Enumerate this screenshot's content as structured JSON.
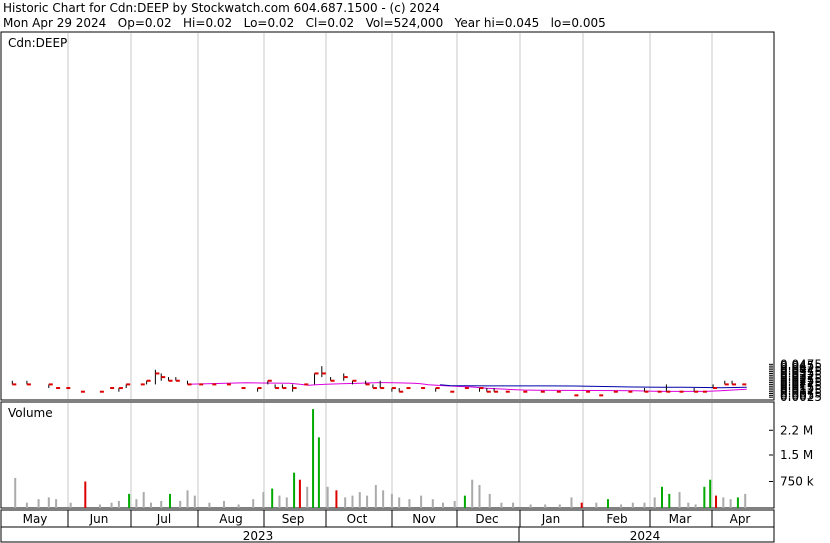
{
  "header": {
    "line1": "Historic Chart for Cdn:DEEP by Stockwatch.com 604.687.1500 - (c) 2024",
    "line2": "Mon Apr 29 2024   Op=0.02   Hi=0.02   Lo=0.02   Cl=0.02   Vol=524,000   Year hi=0.045   lo=0.005"
  },
  "price_panel": {
    "label": "Cdn:DEEP"
  },
  "volume_panel": {
    "label": "Volume"
  },
  "chart_data": [
    {
      "type": "line",
      "title": "Cdn:DEEP",
      "ylim": [
        0,
        0.05
      ],
      "y_ticks": [
        "0.0025",
        "0.005",
        "0.0075",
        "0.01",
        "0.0125",
        "0.015",
        "0.0175",
        "0.02",
        "0.0225",
        "0.025",
        "0.0275",
        "0.03",
        "0.0325",
        "0.035",
        "0.0375",
        "0.04",
        "0.0425",
        "0.045",
        "0.0475"
      ],
      "x_ticks": [
        "May",
        "Jun",
        "Jul",
        "Aug",
        "Sep",
        "Oct",
        "Nov",
        "Dec",
        "Jan",
        "Feb",
        "Mar",
        "Apr"
      ],
      "year_labels": [
        "2023",
        "2024"
      ],
      "colors": {
        "bar": "#000000",
        "close": "#dd0000",
        "ma_short": "#dd00dd",
        "ma_long": "#0000aa",
        "grid": "#c8c8c8"
      },
      "bars": [
        {
          "x": 0.5,
          "lo": 0.02,
          "hi": 0.025,
          "c": 0.02
        },
        {
          "x": 1.5,
          "lo": 0.02,
          "hi": 0.025,
          "c": 0.02
        },
        {
          "x": 3,
          "lo": 0.015,
          "hi": 0.02,
          "c": 0.02
        },
        {
          "x": 3.5,
          "lo": 0.015,
          "hi": 0.015,
          "c": 0.015
        },
        {
          "x": 4.2,
          "lo": 0.015,
          "hi": 0.015,
          "c": 0.015
        },
        {
          "x": 5.2,
          "lo": 0.01,
          "hi": 0.01,
          "c": 0.01
        },
        {
          "x": 6.5,
          "lo": 0.01,
          "hi": 0.01,
          "c": 0.01
        },
        {
          "x": 7.2,
          "lo": 0.015,
          "hi": 0.015,
          "c": 0.015
        },
        {
          "x": 7.8,
          "lo": 0.01,
          "hi": 0.015,
          "c": 0.015
        },
        {
          "x": 8.3,
          "lo": 0.015,
          "hi": 0.02,
          "c": 0.02
        },
        {
          "x": 9.3,
          "lo": 0.02,
          "hi": 0.02,
          "c": 0.02
        },
        {
          "x": 9.7,
          "lo": 0.02,
          "hi": 0.025,
          "c": 0.025
        },
        {
          "x": 10.3,
          "lo": 0.02,
          "hi": 0.04,
          "c": 0.035
        },
        {
          "x": 10.7,
          "lo": 0.025,
          "hi": 0.035,
          "c": 0.03
        },
        {
          "x": 11.2,
          "lo": 0.025,
          "hi": 0.03,
          "c": 0.025
        },
        {
          "x": 11.7,
          "lo": 0.025,
          "hi": 0.03,
          "c": 0.025
        },
        {
          "x": 12.5,
          "lo": 0.02,
          "hi": 0.025,
          "c": 0.02
        },
        {
          "x": 13.3,
          "lo": 0.02,
          "hi": 0.02,
          "c": 0.02
        },
        {
          "x": 14.2,
          "lo": 0.02,
          "hi": 0.02,
          "c": 0.02
        },
        {
          "x": 15.2,
          "lo": 0.02,
          "hi": 0.02,
          "c": 0.02
        },
        {
          "x": 16.2,
          "lo": 0.015,
          "hi": 0.015,
          "c": 0.015
        },
        {
          "x": 17.3,
          "lo": 0.01,
          "hi": 0.015,
          "c": 0.015
        },
        {
          "x": 18,
          "lo": 0.02,
          "hi": 0.025,
          "c": 0.025
        },
        {
          "x": 18.5,
          "lo": 0.015,
          "hi": 0.02,
          "c": 0.015
        },
        {
          "x": 19,
          "lo": 0.015,
          "hi": 0.02,
          "c": 0.015
        },
        {
          "x": 19.7,
          "lo": 0.01,
          "hi": 0.02,
          "c": 0.015
        },
        {
          "x": 20.5,
          "lo": 0.02,
          "hi": 0.02,
          "c": 0.02
        },
        {
          "x": 21.2,
          "lo": 0.02,
          "hi": 0.035,
          "c": 0.035
        },
        {
          "x": 21.7,
          "lo": 0.03,
          "hi": 0.045,
          "c": 0.035
        },
        {
          "x": 22.3,
          "lo": 0.025,
          "hi": 0.03,
          "c": 0.025
        },
        {
          "x": 23.2,
          "lo": 0.025,
          "hi": 0.035,
          "c": 0.03
        },
        {
          "x": 23.8,
          "lo": 0.02,
          "hi": 0.025,
          "c": 0.025
        },
        {
          "x": 24.7,
          "lo": 0.02,
          "hi": 0.025,
          "c": 0.02
        },
        {
          "x": 25.2,
          "lo": 0.015,
          "hi": 0.02,
          "c": 0.015
        },
        {
          "x": 25.7,
          "lo": 0.015,
          "hi": 0.025,
          "c": 0.015
        },
        {
          "x": 26.5,
          "lo": 0.01,
          "hi": 0.015,
          "c": 0.015
        },
        {
          "x": 27,
          "lo": 0.01,
          "hi": 0.015,
          "c": 0.01
        },
        {
          "x": 27.5,
          "lo": 0.015,
          "hi": 0.015,
          "c": 0.015
        },
        {
          "x": 28.5,
          "lo": 0.015,
          "hi": 0.015,
          "c": 0.015
        },
        {
          "x": 29.5,
          "lo": 0.01,
          "hi": 0.015,
          "c": 0.015
        },
        {
          "x": 30.5,
          "lo": 0.01,
          "hi": 0.01,
          "c": 0.01
        },
        {
          "x": 31.5,
          "lo": 0.015,
          "hi": 0.015,
          "c": 0.015
        },
        {
          "x": 32.5,
          "lo": 0.01,
          "hi": 0.015,
          "c": 0.015
        },
        {
          "x": 33,
          "lo": 0.01,
          "hi": 0.015,
          "c": 0.01
        },
        {
          "x": 33.5,
          "lo": 0.01,
          "hi": 0.015,
          "c": 0.01
        },
        {
          "x": 34.3,
          "lo": 0.01,
          "hi": 0.01,
          "c": 0.01
        },
        {
          "x": 35.5,
          "lo": 0.01,
          "hi": 0.01,
          "c": 0.01
        },
        {
          "x": 36.7,
          "lo": 0.01,
          "hi": 0.01,
          "c": 0.01
        },
        {
          "x": 37.8,
          "lo": 0.01,
          "hi": 0.01,
          "c": 0.01
        },
        {
          "x": 39,
          "lo": 0.005,
          "hi": 0.005,
          "c": 0.005
        },
        {
          "x": 39.8,
          "lo": 0.01,
          "hi": 0.01,
          "c": 0.01
        },
        {
          "x": 40.7,
          "lo": 0.005,
          "hi": 0.005,
          "c": 0.005
        },
        {
          "x": 41.7,
          "lo": 0.01,
          "hi": 0.01,
          "c": 0.01
        },
        {
          "x": 42.7,
          "lo": 0.01,
          "hi": 0.01,
          "c": 0.01
        },
        {
          "x": 43.8,
          "lo": 0.01,
          "hi": 0.015,
          "c": 0.01
        },
        {
          "x": 44.7,
          "lo": 0.01,
          "hi": 0.01,
          "c": 0.01
        },
        {
          "x": 45.3,
          "lo": 0.01,
          "hi": 0.02,
          "c": 0.01
        },
        {
          "x": 46.2,
          "lo": 0.01,
          "hi": 0.01,
          "c": 0.01
        },
        {
          "x": 47.2,
          "lo": 0.01,
          "hi": 0.015,
          "c": 0.01
        },
        {
          "x": 47.8,
          "lo": 0.01,
          "hi": 0.01,
          "c": 0.01
        },
        {
          "x": 48.5,
          "lo": 0.015,
          "hi": 0.02,
          "c": 0.015
        },
        {
          "x": 49.3,
          "lo": 0.02,
          "hi": 0.025,
          "c": 0.02
        },
        {
          "x": 49.8,
          "lo": 0.02,
          "hi": 0.025,
          "c": 0.02
        },
        {
          "x": 50.5,
          "lo": 0.02,
          "hi": 0.02,
          "c": 0.02
        }
      ],
      "ma_short": [
        [
          12.5,
          0.0202
        ],
        [
          14.5,
          0.0213
        ],
        [
          15.5,
          0.0218
        ],
        [
          16.5,
          0.0222
        ],
        [
          17.5,
          0.0219
        ],
        [
          18.5,
          0.0218
        ],
        [
          19.5,
          0.0215
        ],
        [
          20.2,
          0.0203
        ],
        [
          20.8,
          0.0189
        ],
        [
          21.3,
          0.0196
        ],
        [
          22,
          0.0203
        ],
        [
          23,
          0.0208
        ],
        [
          24,
          0.0214
        ],
        [
          25,
          0.0221
        ],
        [
          26,
          0.0224
        ],
        [
          27,
          0.0221
        ],
        [
          28,
          0.0217
        ],
        [
          28.5,
          0.0209
        ],
        [
          29,
          0.0196
        ],
        [
          30,
          0.0183
        ],
        [
          31,
          0.0172
        ],
        [
          32,
          0.0164
        ],
        [
          33,
          0.0147
        ],
        [
          34,
          0.0137
        ],
        [
          35,
          0.0128
        ],
        [
          35.5,
          0.0123
        ],
        [
          36.5,
          0.0121
        ],
        [
          38,
          0.0118
        ],
        [
          40,
          0.0116
        ],
        [
          42,
          0.0115
        ],
        [
          43,
          0.0114
        ],
        [
          44,
          0.0108
        ],
        [
          45,
          0.0104
        ],
        [
          47,
          0.0104
        ],
        [
          48,
          0.0104
        ],
        [
          49,
          0.0112
        ],
        [
          50,
          0.0124
        ],
        [
          50.8,
          0.0133
        ]
      ],
      "ma_long": [
        [
          29.8,
          0.0195
        ],
        [
          30.5,
          0.0183
        ],
        [
          31.5,
          0.0181
        ],
        [
          33,
          0.018
        ],
        [
          35,
          0.0179
        ],
        [
          37,
          0.0179
        ],
        [
          39,
          0.0178
        ],
        [
          40,
          0.0174
        ],
        [
          41,
          0.0171
        ],
        [
          42,
          0.0167
        ],
        [
          43,
          0.0165
        ],
        [
          44,
          0.0163
        ],
        [
          45,
          0.0161
        ],
        [
          46.5,
          0.016
        ],
        [
          48,
          0.0158
        ],
        [
          49,
          0.0155
        ],
        [
          50,
          0.0158
        ],
        [
          50.8,
          0.016
        ]
      ]
    },
    {
      "type": "bar",
      "title": "Volume",
      "ylim": [
        0,
        3000000
      ],
      "y_ticks": [
        "750 k",
        "1.5 M",
        "2.2 M"
      ],
      "colors": {
        "black": "#000000",
        "red": "#dd0000",
        "green": "#00aa00",
        "grey": "#aaaaaa"
      },
      "bars": [
        {
          "x": 0.7,
          "v": 850000,
          "c": "grey"
        },
        {
          "x": 1.5,
          "v": 150000,
          "c": "grey"
        },
        {
          "x": 2.3,
          "v": 250000,
          "c": "grey"
        },
        {
          "x": 3,
          "v": 300000,
          "c": "grey"
        },
        {
          "x": 3.5,
          "v": 250000,
          "c": "grey"
        },
        {
          "x": 4.5,
          "v": 150000,
          "c": "grey"
        },
        {
          "x": 5.5,
          "v": 750000,
          "c": "red"
        },
        {
          "x": 6.5,
          "v": 100000,
          "c": "grey"
        },
        {
          "x": 7.3,
          "v": 150000,
          "c": "grey"
        },
        {
          "x": 7.8,
          "v": 200000,
          "c": "grey"
        },
        {
          "x": 8.5,
          "v": 400000,
          "c": "green"
        },
        {
          "x": 9,
          "v": 250000,
          "c": "grey"
        },
        {
          "x": 9.5,
          "v": 450000,
          "c": "grey"
        },
        {
          "x": 10,
          "v": 150000,
          "c": "grey"
        },
        {
          "x": 10.7,
          "v": 200000,
          "c": "grey"
        },
        {
          "x": 11.3,
          "v": 400000,
          "c": "green"
        },
        {
          "x": 12,
          "v": 200000,
          "c": "grey"
        },
        {
          "x": 12.5,
          "v": 500000,
          "c": "grey"
        },
        {
          "x": 13,
          "v": 350000,
          "c": "grey"
        },
        {
          "x": 14,
          "v": 150000,
          "c": "grey"
        },
        {
          "x": 15,
          "v": 200000,
          "c": "grey"
        },
        {
          "x": 16,
          "v": 100000,
          "c": "grey"
        },
        {
          "x": 17,
          "v": 250000,
          "c": "grey"
        },
        {
          "x": 17.7,
          "v": 450000,
          "c": "grey"
        },
        {
          "x": 18.3,
          "v": 550000,
          "c": "green"
        },
        {
          "x": 18.8,
          "v": 350000,
          "c": "grey"
        },
        {
          "x": 19.3,
          "v": 300000,
          "c": "grey"
        },
        {
          "x": 19.8,
          "v": 1000000,
          "c": "green"
        },
        {
          "x": 20.2,
          "v": 800000,
          "c": "red"
        },
        {
          "x": 20.7,
          "v": 600000,
          "c": "grey"
        },
        {
          "x": 21.1,
          "v": 2800000,
          "c": "green"
        },
        {
          "x": 21.5,
          "v": 2000000,
          "c": "green"
        },
        {
          "x": 22.1,
          "v": 600000,
          "c": "grey"
        },
        {
          "x": 22.7,
          "v": 500000,
          "c": "red"
        },
        {
          "x": 23.3,
          "v": 300000,
          "c": "grey"
        },
        {
          "x": 23.8,
          "v": 350000,
          "c": "grey"
        },
        {
          "x": 24.3,
          "v": 450000,
          "c": "grey"
        },
        {
          "x": 24.8,
          "v": 350000,
          "c": "grey"
        },
        {
          "x": 25.4,
          "v": 650000,
          "c": "grey"
        },
        {
          "x": 25.9,
          "v": 500000,
          "c": "grey"
        },
        {
          "x": 26.5,
          "v": 400000,
          "c": "grey"
        },
        {
          "x": 27,
          "v": 300000,
          "c": "grey"
        },
        {
          "x": 27.7,
          "v": 250000,
          "c": "grey"
        },
        {
          "x": 28.5,
          "v": 350000,
          "c": "grey"
        },
        {
          "x": 29.3,
          "v": 250000,
          "c": "grey"
        },
        {
          "x": 30,
          "v": 150000,
          "c": "grey"
        },
        {
          "x": 30.8,
          "v": 200000,
          "c": "grey"
        },
        {
          "x": 31.5,
          "v": 350000,
          "c": "green"
        },
        {
          "x": 32,
          "v": 800000,
          "c": "grey"
        },
        {
          "x": 32.5,
          "v": 650000,
          "c": "grey"
        },
        {
          "x": 33.2,
          "v": 400000,
          "c": "grey"
        },
        {
          "x": 34,
          "v": 150000,
          "c": "grey"
        },
        {
          "x": 34.8,
          "v": 150000,
          "c": "grey"
        },
        {
          "x": 36,
          "v": 100000,
          "c": "grey"
        },
        {
          "x": 37,
          "v": 100000,
          "c": "grey"
        },
        {
          "x": 38,
          "v": 100000,
          "c": "grey"
        },
        {
          "x": 38.8,
          "v": 300000,
          "c": "grey"
        },
        {
          "x": 39.5,
          "v": 150000,
          "c": "red"
        },
        {
          "x": 40.5,
          "v": 150000,
          "c": "grey"
        },
        {
          "x": 41.3,
          "v": 250000,
          "c": "green"
        },
        {
          "x": 42.2,
          "v": 100000,
          "c": "grey"
        },
        {
          "x": 43,
          "v": 150000,
          "c": "grey"
        },
        {
          "x": 43.8,
          "v": 150000,
          "c": "grey"
        },
        {
          "x": 44.5,
          "v": 300000,
          "c": "grey"
        },
        {
          "x": 45,
          "v": 600000,
          "c": "green"
        },
        {
          "x": 45.5,
          "v": 400000,
          "c": "green"
        },
        {
          "x": 46.2,
          "v": 450000,
          "c": "grey"
        },
        {
          "x": 46.8,
          "v": 150000,
          "c": "grey"
        },
        {
          "x": 47.3,
          "v": 100000,
          "c": "grey"
        },
        {
          "x": 47.9,
          "v": 600000,
          "c": "green"
        },
        {
          "x": 48.3,
          "v": 800000,
          "c": "green"
        },
        {
          "x": 48.7,
          "v": 350000,
          "c": "red"
        },
        {
          "x": 49.2,
          "v": 300000,
          "c": "grey"
        },
        {
          "x": 49.7,
          "v": 250000,
          "c": "grey"
        },
        {
          "x": 50.2,
          "v": 300000,
          "c": "green"
        },
        {
          "x": 50.7,
          "v": 400000,
          "c": "grey"
        }
      ]
    }
  ]
}
